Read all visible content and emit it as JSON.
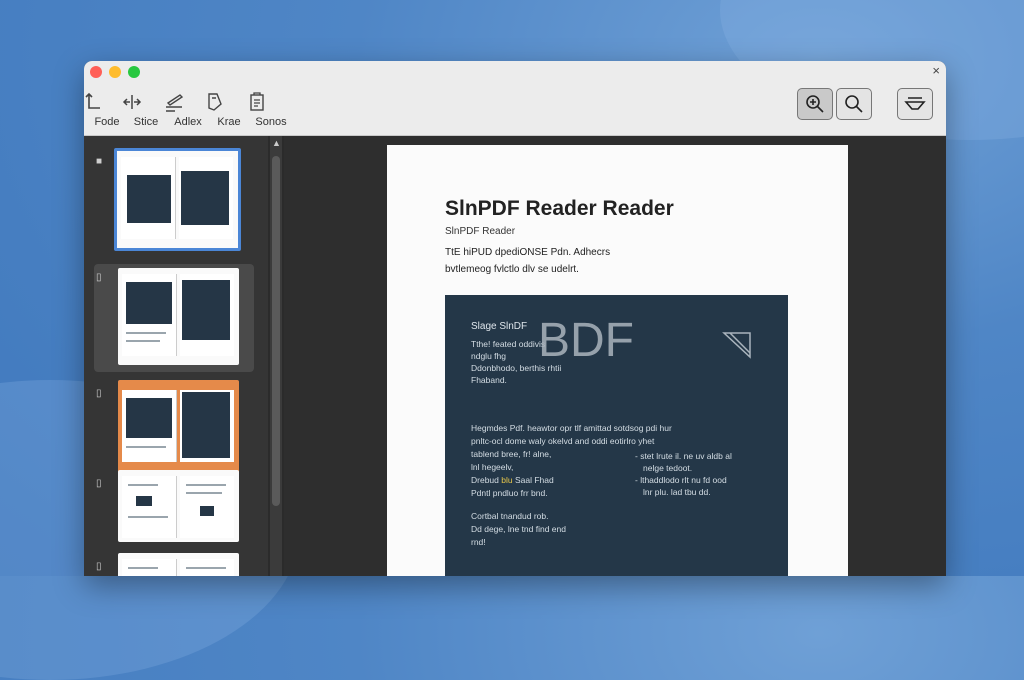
{
  "toolbar": {
    "tools": [
      {
        "label": "Fode",
        "icon": "rotate-icon"
      },
      {
        "label": "Stice",
        "icon": "split-icon"
      },
      {
        "label": "Adlex",
        "icon": "annotate-icon"
      },
      {
        "label": "Krae",
        "icon": "crop-icon"
      },
      {
        "label": "Sonos",
        "icon": "clipboard-icon"
      }
    ],
    "right_buttons": [
      {
        "icon": "zoom-in-icon",
        "active": true
      },
      {
        "icon": "search-icon",
        "active": false
      },
      {
        "icon": "filter-icon",
        "active": false
      }
    ]
  },
  "document": {
    "title": "SlnPDF Reader Reader",
    "subtitle": "SlnPDF Reader",
    "intro_line1": "TtE hiPUD dpediONSE Pdn. Adhecrs",
    "intro_line2": "bvtlemeog fvlctlo dlv se udelrt.",
    "block": {
      "label_line1": "Slage SlnDF",
      "label_line2": "Tthe! feated oddivis",
      "label_line3": "ndglu fhg",
      "label_line4": "Ddonbhodo, berthis rhtii",
      "label_line5": "Fhaband.",
      "big_text": "BDF",
      "para1_line1": "Hegmdes Pdf. heawtor opr tlf amittad sotdsog pdi hur",
      "para1_line2": "pnltc-ocl dome waly okelvd and oddi eotirlro yhet",
      "para1_line3": "tablend bree, fr! alne,",
      "para1_line4": "lnl hegeelv,",
      "para1_line5_pre": "Drebud",
      "para1_line5_hl": "blu",
      "para1_line5_post": "Saal Fhad",
      "para1_line6": "Pdntl pndluo frr bnd.",
      "bullet1_line1": "- stet lrute il. ne uv aldb al",
      "bullet1_line2": "nelge tedoot.",
      "bullet2_line1": "- lthaddlodo rlt nu fd ood",
      "bullet2_line2": "lnr plu. lad tbu dd.",
      "para2_line1": "Cortbal tnandud rob.",
      "para2_line2": "Dd dege, lne tnd find end",
      "para2_line3": "rnd!"
    }
  },
  "colors": {
    "accent": "#4b86d6",
    "block_bg": "#243748"
  }
}
